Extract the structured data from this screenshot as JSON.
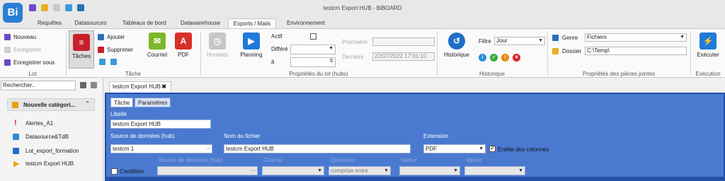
{
  "app": {
    "logo_text": "Bi",
    "window_title": "testcm Export HUB - BiBOARD"
  },
  "tabs": [
    {
      "label": "Requêtes"
    },
    {
      "label": "Datasources"
    },
    {
      "label": "Tableaux de bord"
    },
    {
      "label": "Datawarehouse"
    },
    {
      "label": "Exports / Mails"
    },
    {
      "label": "Environnement"
    }
  ],
  "ribbon": {
    "lot": {
      "nouveau": "Nouveau",
      "enregistrer": "Enregistrer",
      "enregistrer_sous": "Enregistrer sous",
      "group": "Lot"
    },
    "tache": {
      "taches": "Tâches",
      "ajouter": "Ajouter",
      "supprimer": "Supprimer",
      "courriel": "Courriel",
      "pdf": "PDF",
      "group": "Tâche"
    },
    "props": {
      "horaires": "Horaires",
      "planning": "Planning",
      "actif": "Actif",
      "differe": "Différé",
      "a": "à",
      "prochaine": "Prochaine",
      "derniere": "Dernière",
      "derniere_value": "22/07/2022 17:01:10",
      "group": "Propriétés du lot (hubs)"
    },
    "historique": {
      "button": "Historique",
      "filtre": "Filtre",
      "filtre_value": "Jour",
      "group": "Historique"
    },
    "pieces": {
      "genre": "Genre",
      "genre_value": "Fichiers",
      "dossier": "Dossier",
      "dossier_value": "C:\\Temp\\",
      "group": "Propriétés des pièces jointes"
    },
    "execution": {
      "executer": "Exécuter",
      "group": "Exécution"
    }
  },
  "left": {
    "search_value": "Rechercher..",
    "category": "Nouvelle catégori...",
    "items": [
      {
        "label": "Alertes_A1"
      },
      {
        "label": "Datasource&TdB"
      },
      {
        "label": "Lot_export_formation"
      },
      {
        "label": "testcm Export HUB"
      }
    ]
  },
  "content": {
    "doc_tab": "testcm Export HUB",
    "doc_tab_close": "✖",
    "subtabs": [
      {
        "label": "Tâche"
      },
      {
        "label": "Paramètres"
      }
    ],
    "libelle_label": "Libellé",
    "libelle_value": "testcm Export HUB",
    "source_label": "Source de données (hub)",
    "source_value": "testcm 1",
    "nom_label": "Nom du fichier",
    "nom_value": "testcm Export HUB",
    "extension_label": "Extension",
    "extension_value": "PDF",
    "entete_label": "Entête des colonnes",
    "condition_label": "Condition",
    "cond_source_label": "Source de données (hub)",
    "champ_label": "Champ",
    "operateur_label": "Opérateur",
    "operateur_value": "comprise entre",
    "valeur_label": "Valeur",
    "valeur2_label": "Valeur"
  },
  "colors": {
    "accent_blue": "#4a7ad0",
    "dark_blue": "#1f4fa8",
    "logo_blue": "#2a7fd4"
  }
}
